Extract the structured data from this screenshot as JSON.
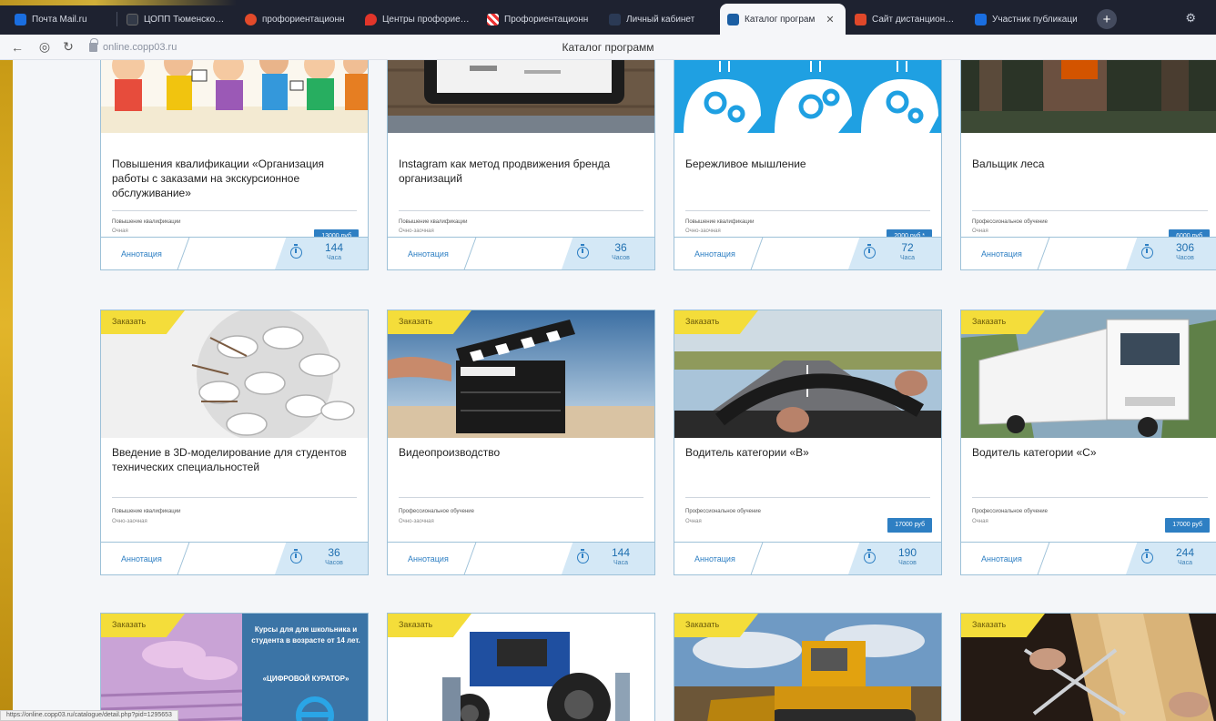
{
  "browser": {
    "tabs": [
      {
        "label": "Почта Mail.ru",
        "color": "#1a6ee0"
      },
      {
        "label": "ЦОПП Тюменской об",
        "color": "#333a48"
      },
      {
        "label": "профориентационн",
        "color": "#e24a2a"
      },
      {
        "label": "Центры профориента",
        "color": "#e2352a"
      },
      {
        "label": "Профориентационн",
        "color": "#e8e8e8"
      },
      {
        "label": "Личный кабинет",
        "color": "#2b3a55"
      },
      {
        "label": "Каталог програм",
        "color": "#1b5ea3",
        "active": true
      },
      {
        "label": "Сайт дистанционного",
        "color": "#e0482a"
      },
      {
        "label": "Участник публикаци",
        "color": "#1a6ee0"
      }
    ],
    "new_tab": "+",
    "url": "online.copp03.ru",
    "page_title": "Каталог программ",
    "status_url": "https://online.copp03.ru/catalogue/detail.php?pid=1295653"
  },
  "cards": [
    {
      "badge": "",
      "title": "Повышения квалификации «Организация работы с заказами на экскурсионное обслуживание»",
      "type": "Повышение квалификации",
      "form": "Очная",
      "price": "13000 руб",
      "hours": "144",
      "hours_unit": "Часа",
      "annotation": "Аннотация",
      "image": "cartoon-kids"
    },
    {
      "badge": "",
      "title": "Instagram как метод продвижения бренда организаций",
      "type": "Повышение квалификации",
      "form": "Очно-заочная",
      "price": "",
      "hours": "36",
      "hours_unit": "Часов",
      "annotation": "Аннотация",
      "image": "tablet-wood"
    },
    {
      "badge": "",
      "title": "Бережливое мышление",
      "type": "Повышение квалификации",
      "form": "Очно-заочная",
      "price": "2000 руб *",
      "hours": "72",
      "hours_unit": "Часа",
      "annotation": "Аннотация",
      "image": "gears-heads"
    },
    {
      "badge": "",
      "title": "Вальщик леса",
      "type": "Профессиональное обучение",
      "form": "Очная",
      "price": "6000 руб",
      "hours": "306",
      "hours_unit": "Часов",
      "annotation": "Аннотация",
      "image": "forest"
    },
    {
      "badge": "Заказать",
      "title": "Введение в 3D-моделирование для студентов технических специальностей",
      "type": "Повышение квалификации",
      "form": "Очно-заочная",
      "price": "",
      "hours": "36",
      "hours_unit": "Часов",
      "annotation": "Аннотация",
      "image": "3d-sphere"
    },
    {
      "badge": "Заказать",
      "title": "Видеопроизводство",
      "type": "Профессиональное обучение",
      "form": "Очно-заочная",
      "price": "",
      "hours": "144",
      "hours_unit": "Часа",
      "annotation": "Аннотация",
      "image": "clapper"
    },
    {
      "badge": "Заказать",
      "title": "Водитель категории «В»",
      "type": "Профессиональное обучение",
      "form": "Очная",
      "price": "17000 руб",
      "hours": "190",
      "hours_unit": "Часов",
      "annotation": "Аннотация",
      "image": "road"
    },
    {
      "badge": "Заказать",
      "title": "Водитель категории «С»",
      "type": "Профессиональное обучение",
      "form": "Очная",
      "price": "17000 руб",
      "hours": "244",
      "hours_unit": "Часа",
      "annotation": "Аннотация",
      "image": "truck"
    },
    {
      "badge": "Заказать",
      "title": "",
      "type": "",
      "form": "",
      "price": "",
      "hours": "",
      "hours_unit": "",
      "annotation": "",
      "image": "keyboard",
      "image_text": [
        "Курсы для для школьника и студента в возрасте от 14 лет.",
        "«ЦИФРОВОЙ КУРАТОР»"
      ]
    },
    {
      "badge": "Заказать",
      "title": "",
      "type": "",
      "form": "",
      "price": "",
      "hours": "",
      "hours_unit": "",
      "annotation": "",
      "image": "tractor"
    },
    {
      "badge": "Заказать",
      "title": "",
      "type": "",
      "form": "",
      "price": "",
      "hours": "",
      "hours_unit": "",
      "annotation": "",
      "image": "bulldozer"
    },
    {
      "badge": "Заказать",
      "title": "",
      "type": "",
      "form": "",
      "price": "",
      "hours": "",
      "hours_unit": "",
      "annotation": "",
      "image": "hair"
    }
  ]
}
